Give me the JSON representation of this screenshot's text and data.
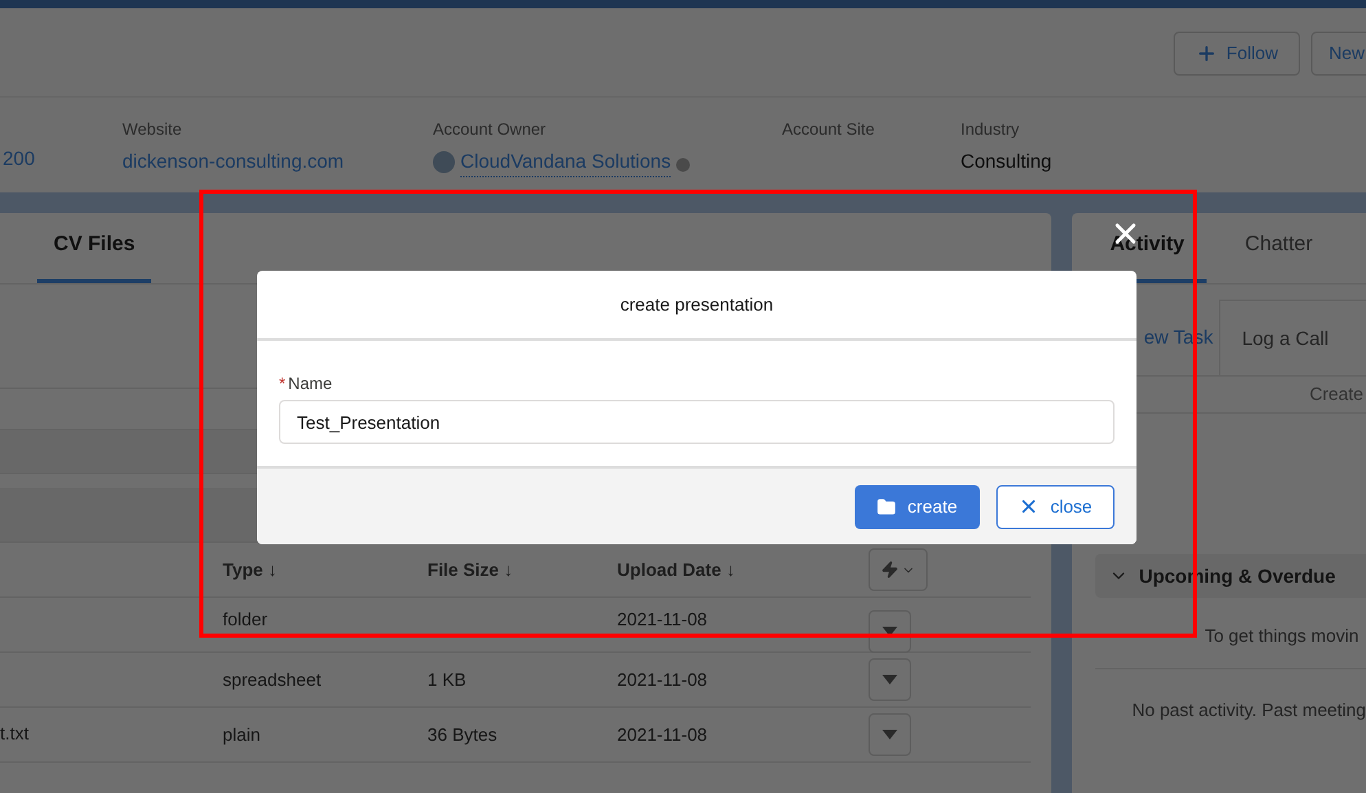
{
  "header": {
    "buttons": [
      {
        "label": "Follow",
        "kind": "follow"
      },
      {
        "label": "New",
        "kind": "plain"
      }
    ]
  },
  "highlights": [
    {
      "value": "200",
      "kind": "link"
    },
    {
      "label": "Website",
      "value": "dickenson-consulting.com",
      "kind": "link"
    },
    {
      "label": "Account Owner",
      "value": "CloudVandana Solutions",
      "kind": "owner"
    },
    {
      "label": "Account Site"
    },
    {
      "label": "Industry",
      "value": "Consulting",
      "kind": "text"
    }
  ],
  "files_panel": {
    "tabs": [
      {
        "label": "CV Files",
        "selected": true
      }
    ],
    "table": {
      "columns": [
        {
          "label": "Type ↓"
        },
        {
          "label": "File Size ↓"
        },
        {
          "label": "Upload Date ↓"
        }
      ],
      "rows": [
        {
          "type": "folder",
          "date": "2021-11-08"
        },
        {
          "type": "spreadsheet",
          "size": "1 KB",
          "date": "2021-11-08"
        },
        {
          "name": "t.txt",
          "type": "plain",
          "size": "36 Bytes",
          "date": "2021-11-08"
        }
      ]
    }
  },
  "activity_panel": {
    "tabs": [
      {
        "label": "Activity",
        "selected": true
      },
      {
        "label": "Chatter",
        "selected": false
      }
    ],
    "actions": [
      "ew Task",
      "Log a Call"
    ],
    "create_label": "Create",
    "section": {
      "title": "Upcoming & Overdue",
      "expanded": true
    },
    "messages": [
      "To get things movin",
      "No past activity. Past meeting"
    ]
  },
  "modal": {
    "title": "create presentation",
    "field": {
      "required_mark": "*",
      "label": "Name",
      "value": "Test_Presentation"
    },
    "buttons": [
      {
        "label": "create",
        "kind": "primary"
      },
      {
        "label": "close",
        "kind": "outline"
      }
    ]
  }
}
